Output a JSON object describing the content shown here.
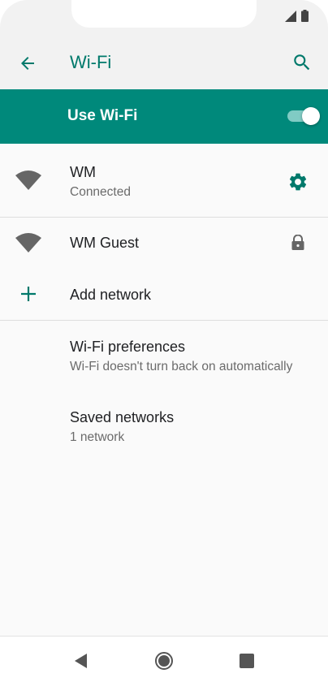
{
  "app_bar": {
    "title": "Wi-Fi",
    "back_icon": "arrow-back-icon",
    "search_icon": "search-icon"
  },
  "master_switch": {
    "label": "Use Wi-Fi",
    "enabled": true
  },
  "networks": [
    {
      "name": "WM",
      "status": "Connected",
      "icon": "wifi-signal-icon",
      "action_icon": "settings-gear-icon"
    },
    {
      "name": "WM Guest",
      "status": "",
      "icon": "wifi-signal-icon",
      "action_icon": "lock-icon"
    }
  ],
  "add_network": {
    "label": "Add network",
    "icon": "plus-icon"
  },
  "preferences": {
    "title": "Wi-Fi preferences",
    "summary": "Wi-Fi doesn't turn back on automatically"
  },
  "saved_networks": {
    "title": "Saved networks",
    "summary": "1 network"
  },
  "colors": {
    "accent": "#00796b",
    "switch_bar": "#00897b",
    "icon_gray": "#666666"
  }
}
